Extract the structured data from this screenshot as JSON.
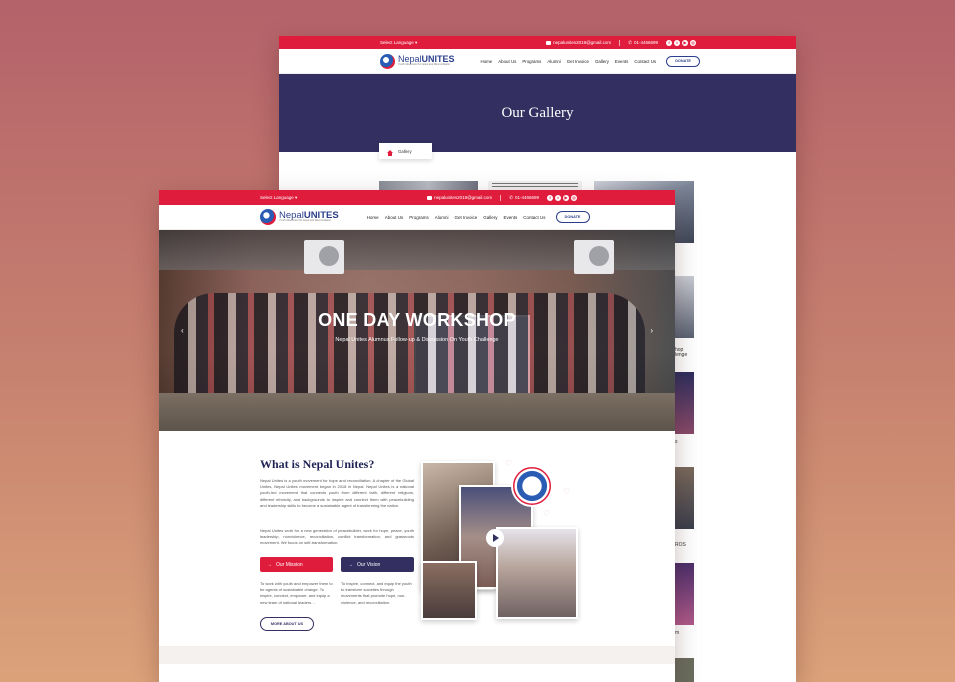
{
  "back_page": {
    "topbar": {
      "language": "Select Language",
      "email": "nepalunites2019@gmail.com",
      "phone": "01-4466699"
    },
    "logo": {
      "name_a": "Nepal",
      "name_b": "UNITES",
      "tagline": "Youth Movement for Hope and Reconciliation"
    },
    "nav": [
      "Home",
      "About Us",
      "Programs",
      "Alumni",
      "Get Invoice",
      "Gallery",
      "Events",
      "Contact Us"
    ],
    "donate": "DONATE",
    "hero_title": "Our Gallery",
    "breadcrumb": "Gallery",
    "captions": [
      "hop",
      "lenge",
      "s",
      "ROS",
      "m"
    ]
  },
  "front_page": {
    "topbar": {
      "language": "Select Language",
      "email": "nepalunites2019@gmail.com",
      "phone": "01-4466699"
    },
    "logo": {
      "name_a": "Nepal",
      "name_b": "UNITES",
      "tagline": "Youth Movement for Hope and Reconciliation"
    },
    "nav": [
      "Home",
      "About Us",
      "Programs",
      "Alumni",
      "Get Invoice",
      "Gallery",
      "Events",
      "Contact Us"
    ],
    "donate": "DONATE",
    "slider": {
      "title": "ONE DAY WORKSHOP",
      "subtitle": "Nepal Unites Alumnus Follow-up & Discussion On Youth Challenge",
      "prev": "‹",
      "next": "›"
    },
    "about": {
      "heading": "What is Nepal Unites?",
      "para1": "Nepal Unites is a youth movement for hope and reconciliation. A chapter of the Global Unites, Nepal Unites movement began in 2018 in Nepal. Nepal Unites is a national youth-led movement that connects youth from different faith, different religions, different ethnicity, and backgrounds to inspire and connect them with peacebuilding and leadership skills to become a sustainable agent of transforming the nation.",
      "para2": "Nepal Unites work for a new generation of peacebuilder, work for hope, peace, youth leadership, nonviolence, reconciliation, conflict transformation, and grassroots movement. We focus on self-transformation.",
      "mission_btn": "Our Mission",
      "vision_btn": "Our Vision",
      "mission_text": "To work with youth and empower them to be agents of sustainable change. To inspire, connect, empower, and equip a new team of national leaders…",
      "vision_text": "To inspire, connect, and equip the youth to transform societies through movements that promote hope, non-violence, and reconciliation.",
      "more_btn": "MORE ABOUT US"
    }
  },
  "colors": {
    "brand_red": "#e01c3c",
    "brand_navy": "#342f61",
    "logo_blue": "#2b3f8c"
  },
  "icons": [
    "envelope-icon",
    "phone-icon",
    "facebook-icon",
    "twitter-icon",
    "youtube-icon",
    "instagram-icon",
    "home-icon",
    "play-icon",
    "arrow-right-icon"
  ]
}
